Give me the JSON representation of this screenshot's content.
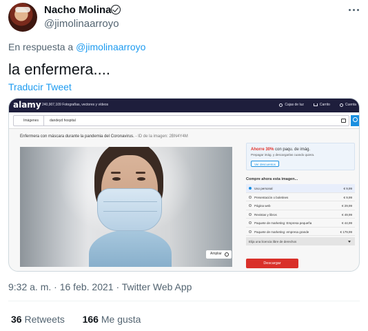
{
  "author": {
    "name": "Nacho Molina",
    "handle": "@jimolinaarroyo"
  },
  "reply": {
    "prefix": "En respuesta a",
    "mention": "@jimolinaarroyo"
  },
  "tweet": {
    "text": "la enfermera....",
    "translate": "Traducir Tweet"
  },
  "media": {
    "logo": "alamy",
    "count_text": "240,907,109 Fotografías, vectores y vídeos",
    "links": [
      "Cajas de luz",
      "Carrito",
      "Cuenta"
    ],
    "search_category": "Imágenes",
    "search_value": "dandeyd hospital",
    "caption": "Enfermera con máscara durante la pandemia del Coronavirus.",
    "caption_id": "- ID de la imagen: 2BN4Y4M",
    "enlarge": "Ampliar",
    "promo_highlight": "Ahorre 30%",
    "promo_rest": "con paqu. de imág.",
    "promo_sub": "Prepagar imág. y descargarlas cuando quiera.",
    "promo_button": "Ver descuentos",
    "buy_title": "Compre ahora esta imagen...",
    "options": [
      {
        "label": "Uso personal",
        "price": "€ 9,99",
        "selected": true
      },
      {
        "label": "Presentación o boletines",
        "price": "€ 9,99",
        "selected": false
      },
      {
        "label": "Página web",
        "price": "€ 29,99",
        "selected": false
      },
      {
        "label": "Revistas y libros",
        "price": "€ 49,99",
        "selected": false
      },
      {
        "label": "Paquete de marketing: Empresa pequeña",
        "price": "€ 44,99",
        "selected": false
      },
      {
        "label": "Paquete de marketing: empresa grande",
        "price": "€ 179,99",
        "selected": false
      }
    ],
    "license_select": "Elija una licencia libre de derechos",
    "download": "Descargar"
  },
  "meta": {
    "time": "9:32 a. m.",
    "date": "16 feb. 2021",
    "app": "Twitter Web App",
    "sep": "·"
  },
  "stats": {
    "retweets_count": "36",
    "retweets_label": "Retweets",
    "likes_count": "166",
    "likes_label": "Me gusta"
  },
  "colors": {
    "link": "#1d9bf0",
    "secondary": "#536471",
    "alamy_bar": "#1e1e3c",
    "download": "#d9302a"
  },
  "icons": [
    "verified-icon",
    "more-icon",
    "search-icon",
    "camera-icon",
    "cart-icon"
  ]
}
